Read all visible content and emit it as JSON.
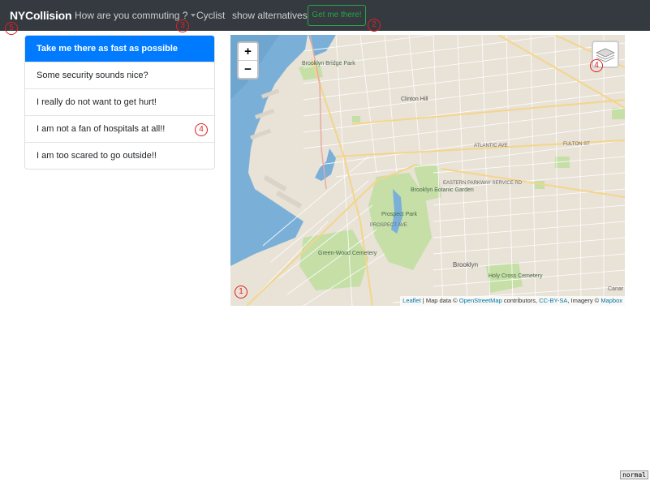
{
  "navbar": {
    "brand": "NYCollision",
    "dropdown_label": "How are you commuting ?",
    "cyclist_label": "Cyclist",
    "alternatives_label": "show alternatives",
    "go_button_label": "Get me there!"
  },
  "markers": {
    "brand": "5",
    "dropdown": "3",
    "go_button": "2",
    "list": "4",
    "layers": "4",
    "map": "1"
  },
  "route_preferences": [
    {
      "label": "Take me there as fast as possible",
      "active": true
    },
    {
      "label": "Some security sounds nice?",
      "active": false
    },
    {
      "label": "I really do not want to get hurt!",
      "active": false
    },
    {
      "label": "I am not a fan of hospitals at all!!",
      "active": false
    },
    {
      "label": "I am too scared to go outside!!",
      "active": false
    }
  ],
  "map": {
    "zoom_in": "+",
    "zoom_out": "−",
    "attribution": {
      "leaflet": "Leaflet",
      "sep": " | Map data © ",
      "osm": "OpenStreetMap",
      "contrib": " contributors, ",
      "license": "CC-BY-SA",
      "imagery": ", Imagery © ",
      "mapbox": "Mapbox"
    },
    "labels": {
      "brooklyn_bridge_park": "Brooklyn Bridge Park",
      "clinton_hill": "Clinton Hill",
      "prospect_park": "Prospect Park",
      "brooklyn_botanic_garden": "Brooklyn Botanic Garden",
      "green_wood_cemetery": "Green-Wood Cemetery",
      "brooklyn": "Brooklyn",
      "holy_cross_cemetery": "Holy Cross Cemetery",
      "atlantic_ave": "ATLANTIC AVE",
      "fulton_st": "FULTON ST",
      "eastern_parkway": "EASTERN PARKWAY SERVICE RD",
      "prospect_ave": "PROSPECT AVE",
      "canarsie": "Canar"
    },
    "colors": {
      "water": "#7ab0d8",
      "land": "#e8e2d7",
      "park": "#c5dfa7"
    }
  },
  "mode_badge": "normal"
}
